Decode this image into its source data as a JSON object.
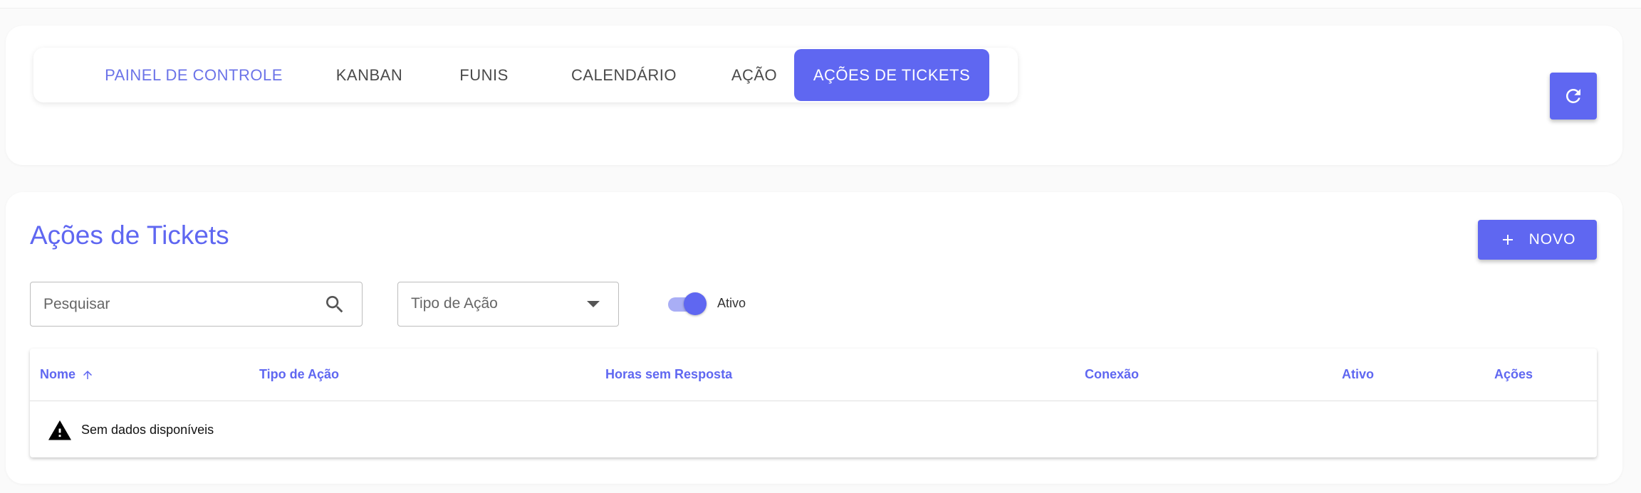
{
  "tabs": [
    {
      "label": "PAINEL DE CONTROLE",
      "active": false
    },
    {
      "label": "KANBAN",
      "active": false
    },
    {
      "label": "FUNIS",
      "active": false
    },
    {
      "label": "CALENDÁRIO",
      "active": false
    },
    {
      "label": "AÇÃO",
      "active": false
    },
    {
      "label": "AÇÕES DE TICKETS",
      "active": true
    }
  ],
  "header": {
    "refresh_icon": "refresh-icon"
  },
  "main": {
    "title": "Ações de Tickets",
    "new_button": {
      "label": "NOVO",
      "icon": "plus-icon"
    },
    "filters": {
      "search_placeholder": "Pesquisar",
      "search_value": "",
      "action_type_label": "Tipo de Ação",
      "active_toggle": {
        "label": "Ativo",
        "on": true
      }
    },
    "table": {
      "columns": [
        "Nome",
        "Tipo de Ação",
        "Horas sem Resposta",
        "Conexão",
        "Ativo",
        "Ações"
      ],
      "sorted_column": "Nome",
      "sort_direction": "asc",
      "empty_message": "Sem dados disponíveis"
    }
  },
  "colors": {
    "accent": "#5f67f1",
    "accent_light": "#a9aef5",
    "tab_text": "#4a4a4a"
  }
}
